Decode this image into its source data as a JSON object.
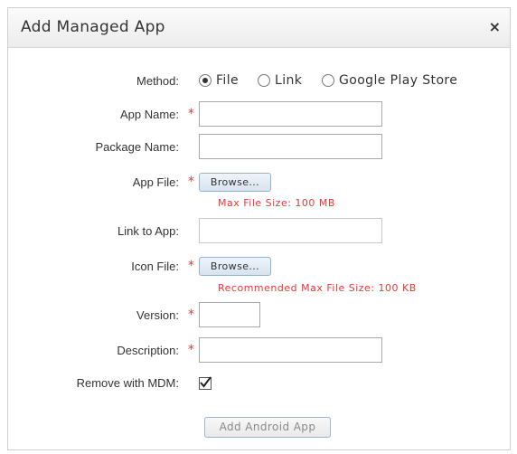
{
  "dialog": {
    "title": "Add Managed App",
    "close_glyph": "×"
  },
  "method": {
    "label": "Method:",
    "options": [
      {
        "label": "File",
        "checked": true
      },
      {
        "label": "Link",
        "checked": false
      },
      {
        "label": "Google Play Store",
        "checked": false
      }
    ]
  },
  "fields": {
    "app_name": {
      "label": "App Name:",
      "value": "",
      "required": true
    },
    "package_name": {
      "label": "Package Name:",
      "value": "",
      "required": false
    },
    "app_file": {
      "label": "App File:",
      "button": "Browse...",
      "hint": "Max File Size: 100 MB",
      "required": true
    },
    "link_to_app": {
      "label": "Link to App:",
      "value": "",
      "required": false
    },
    "icon_file": {
      "label": "Icon File:",
      "button": "Browse...",
      "hint": "Recommended Max File Size: 100 KB",
      "required": true
    },
    "version": {
      "label": "Version:",
      "value": "",
      "required": true
    },
    "description": {
      "label": "Description:",
      "value": "",
      "required": true
    },
    "remove_with_mdm": {
      "label": "Remove with MDM:",
      "checked": true
    }
  },
  "required_marker": "*",
  "submit": {
    "label": "Add Android App",
    "enabled": false
  },
  "icons": {
    "close": "close-icon",
    "check": "checkmark-icon"
  }
}
